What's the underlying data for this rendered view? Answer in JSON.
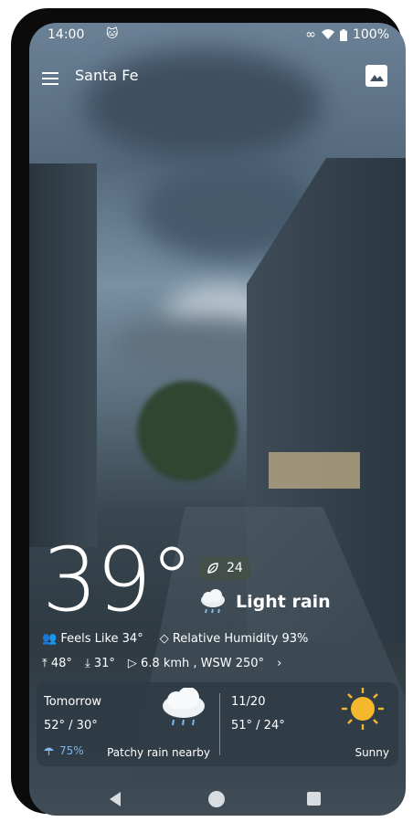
{
  "status_bar": {
    "time": "14:00",
    "battery": "100%"
  },
  "header": {
    "city": "Santa Fe"
  },
  "current": {
    "temperature": "39°",
    "air_quality": "24",
    "condition": "Light rain",
    "feels_like": "Feels Like 34°",
    "humidity": "Relative Humidity 93%",
    "high": "48°",
    "low": "31°",
    "wind": "6.8 kmh , WSW 250°"
  },
  "forecast": [
    {
      "day": "Tomorrow",
      "temps": "52° / 30°",
      "rain_chance": "75%",
      "description": "Patchy rain nearby",
      "icon": "rain-cloud-icon"
    },
    {
      "day": "11/20",
      "temps": "51° / 24°",
      "description": "Sunny",
      "icon": "sun-icon"
    }
  ],
  "colors": {
    "rain_accent": "#7fb7e8",
    "sun": "#f5b72c"
  }
}
